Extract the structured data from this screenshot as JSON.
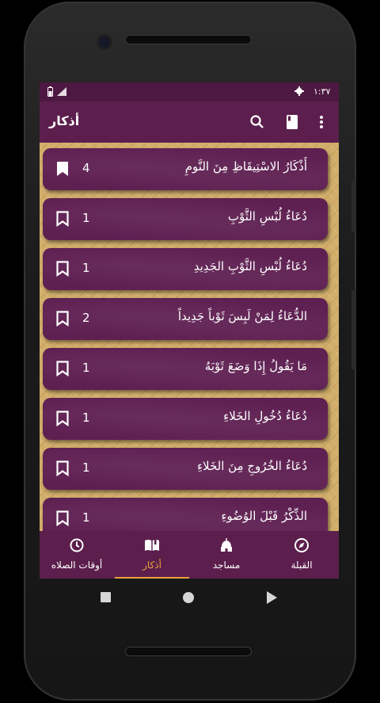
{
  "status": {
    "time": "١:٣٧"
  },
  "appbar": {
    "title": "أذكار",
    "icons": [
      "more-vert-icon",
      "book-icon",
      "search-icon"
    ]
  },
  "list": [
    {
      "title": "أَذْكَارُ الاسْتِيقَاظِ مِنَ النَّومِ",
      "count": "4"
    },
    {
      "title": "دُعَاءُ لُبْسِ الثَّوْبِ",
      "count": "1"
    },
    {
      "title": "دُعَاءُ لُبْسِ الثَّوْبِ الجَدِيدِ",
      "count": "1"
    },
    {
      "title": "الدُّعَاءُ لِمَنْ لَبِسَ ثَوْباً جَدِيداً",
      "count": "2"
    },
    {
      "title": "مَا يَقُولُ إِذَا وَضَعَ ثَوْبَهُ",
      "count": "1"
    },
    {
      "title": "دُعَاءُ دُخُولِ الخَلاءِ",
      "count": "1"
    },
    {
      "title": "دُعَاءُ الخُرُوجِ مِنَ الخَلاءِ",
      "count": "1"
    },
    {
      "title": "الذِّكْرُ قَبْلَ الوُضُوءِ",
      "count": "1"
    }
  ],
  "nav": {
    "prayer_times": "أوقات الصلاه",
    "azkar": "أذكار",
    "mosques": "مساجد",
    "qibla": "القبلة",
    "active": "azkar",
    "accent": "#e8a33c"
  },
  "colors": {
    "primary": "#5c1f4d",
    "card": "#5e1f51",
    "background": "#d2ae6b"
  }
}
